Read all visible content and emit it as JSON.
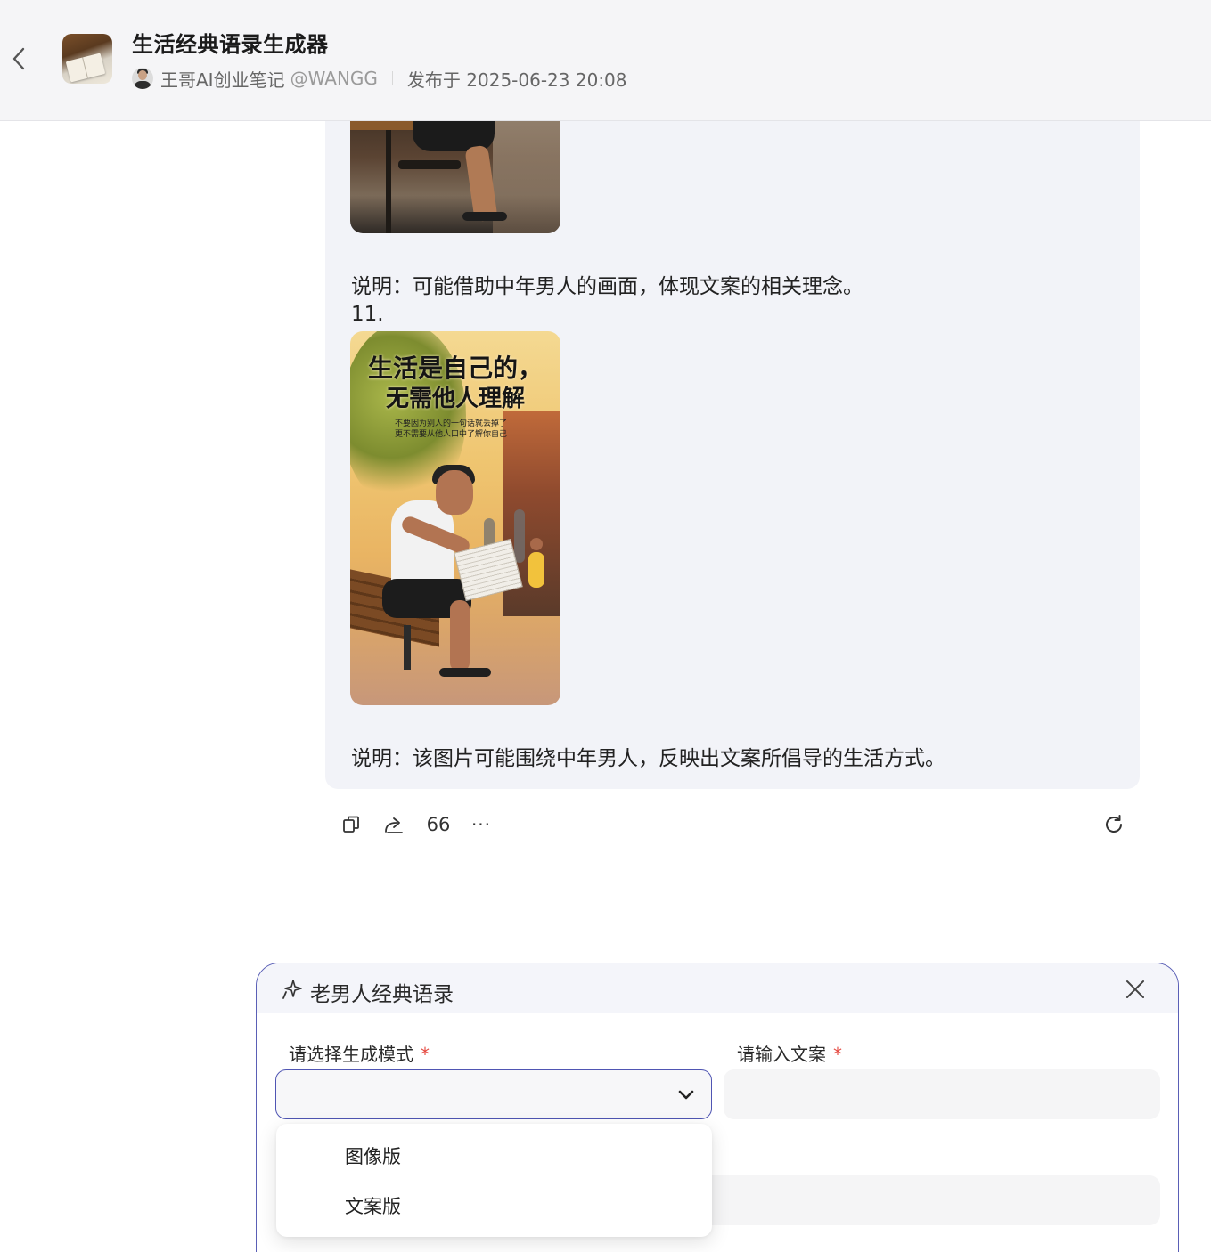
{
  "header": {
    "app_title": "生活经典语录生成器",
    "author_name": "王哥AI创业笔记",
    "author_handle": "@WANGG",
    "publish_date": "发布于 2025-06-23 20:08"
  },
  "message": {
    "caption_1": "说明：可能借助中年男人的画面，体现文案的相关理念。",
    "item_number": "11.",
    "image_headline_1": "生活是自己的，",
    "image_headline_2": "无需他人理解",
    "image_sub_1": "不要因为别人的一句话就丢掉了",
    "image_sub_2": "更不需要从他人口中了解你自己",
    "caption_2": "说明：该图片可能围绕中年男人，反映出文案所倡导的生活方式。"
  },
  "actions": {
    "quote_label": "66",
    "more_label": "···"
  },
  "panel": {
    "title": "老男人经典语录",
    "mode_label": "请选择生成模式",
    "copy_label": "请输入文案",
    "required_mark": "*",
    "mode_options": [
      "图像版",
      "文案版"
    ]
  },
  "colors": {
    "accent": "#4f55b3",
    "required": "#e5483f",
    "bubble_bg": "#f2f3f8",
    "header_bg": "#f5f5f7"
  },
  "icons": [
    "chevron-left-icon",
    "copy-icon",
    "share-icon",
    "quote-icon",
    "more-icon",
    "refresh-icon",
    "sparkle-icon",
    "close-icon",
    "chevron-down-icon"
  ]
}
